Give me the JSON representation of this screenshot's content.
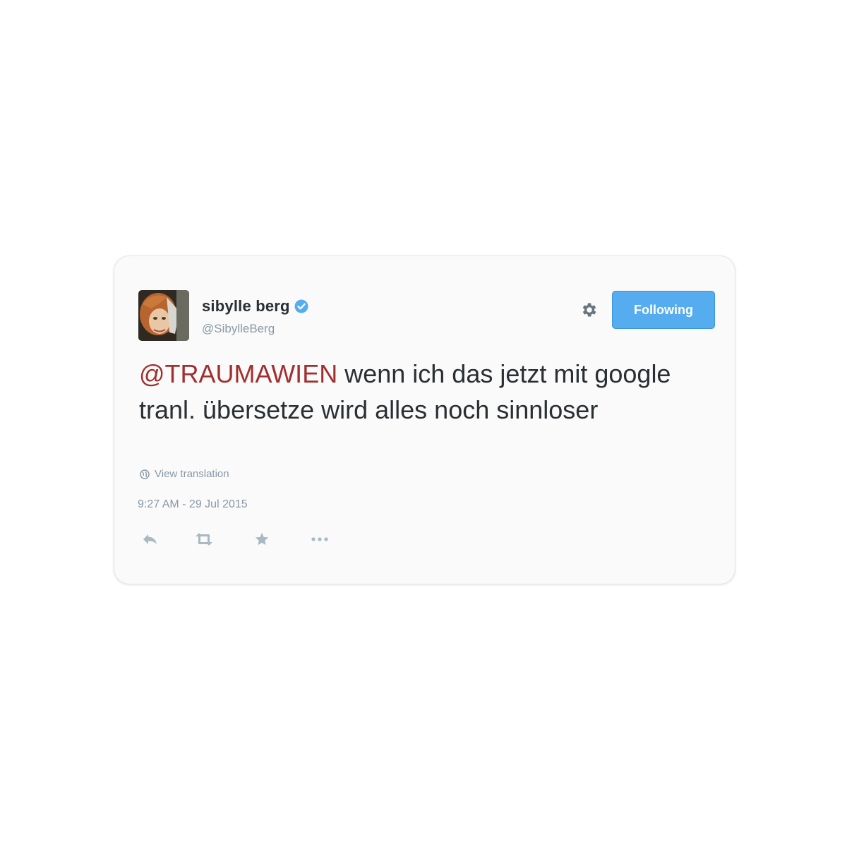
{
  "tweet": {
    "display_name": "sibylle berg",
    "handle": "@SibylleBerg",
    "verified": true,
    "mention": "@TRAUMAWIEN",
    "text": " wenn ich das jetzt mit google tranl. übersetze wird alles noch sinnloser",
    "translation_label": "View translation",
    "timestamp": "9:27 AM - 29 Jul 2015"
  },
  "follow_button": {
    "label": "Following"
  },
  "actions": [
    {
      "name": "reply",
      "icon": "reply-icon"
    },
    {
      "name": "retweet",
      "icon": "retweet-icon"
    },
    {
      "name": "favorite",
      "icon": "star-icon"
    },
    {
      "name": "more",
      "icon": "more-icon"
    }
  ],
  "colors": {
    "accent": "#55acee",
    "mention": "#a0302e",
    "text": "#292f33",
    "muted": "#8899a6",
    "verified": "#55acee"
  }
}
